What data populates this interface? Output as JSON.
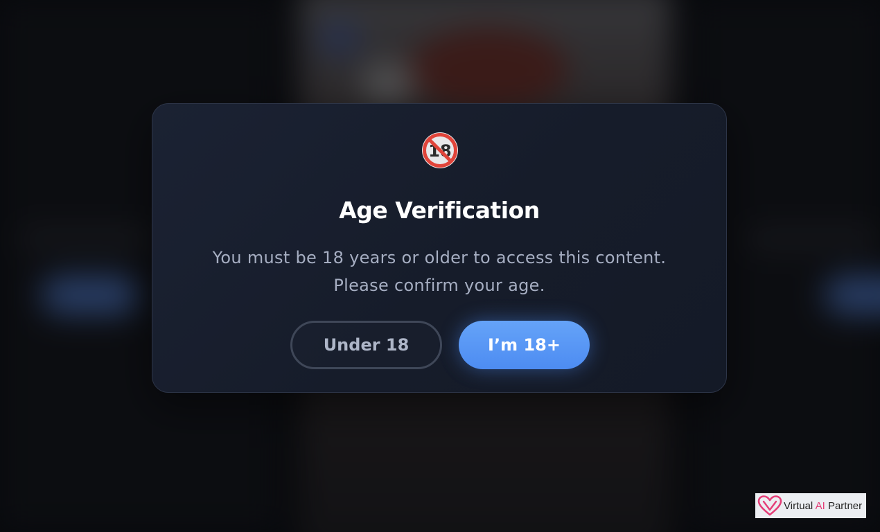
{
  "modal": {
    "icon": "no-one-under-eighteen-icon",
    "icon_text": "18",
    "title": "Age Verification",
    "message_line1": "You must be 18 years or older to access this content.",
    "message_line2": "Please confirm your age."
  },
  "buttons": {
    "under_label": "Under 18",
    "adult_label": "I’m 18+"
  },
  "brand": {
    "name_prefix": "Virtual ",
    "name_highlight": "AI",
    "name_suffix": " Partner",
    "logo_icon": "heart-logo-icon"
  },
  "colors": {
    "accent": "#5b9af5",
    "modal_bg": "#171d2b",
    "brand_pink": "#e53e78"
  }
}
